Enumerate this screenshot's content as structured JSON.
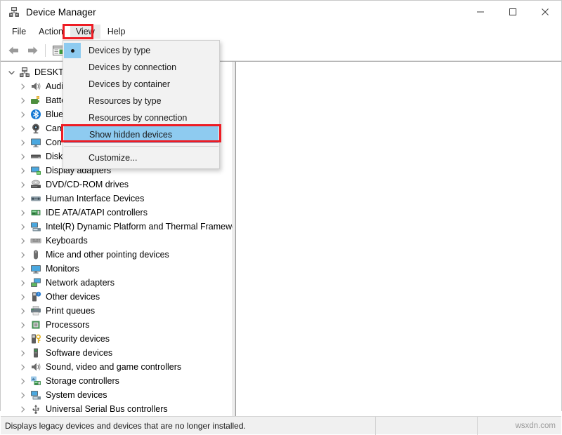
{
  "window": {
    "title": "Device Manager",
    "icon": "device-manager-icon",
    "controls": {
      "minimize": "minimize-icon",
      "maximize": "maximize-icon",
      "close": "close-icon"
    }
  },
  "menubar": {
    "items": [
      {
        "label": "File",
        "open": false
      },
      {
        "label": "Action",
        "open": false
      },
      {
        "label": "View",
        "open": true
      },
      {
        "label": "Help",
        "open": false
      }
    ],
    "highlighted_item": "View"
  },
  "toolbar": {
    "buttons": [
      {
        "name": "back-button",
        "icon": "back-arrow-icon"
      },
      {
        "name": "forward-button",
        "icon": "forward-arrow-icon"
      },
      {
        "name": "properties-button",
        "icon": "properties-icon"
      }
    ]
  },
  "view_menu": {
    "items": [
      {
        "label": "Devices by type",
        "checked": true,
        "highlighted": false,
        "separator_before": false
      },
      {
        "label": "Devices by connection",
        "checked": false,
        "highlighted": false,
        "separator_before": false
      },
      {
        "label": "Devices by container",
        "checked": false,
        "highlighted": false,
        "separator_before": false
      },
      {
        "label": "Resources by type",
        "checked": false,
        "highlighted": false,
        "separator_before": false
      },
      {
        "label": "Resources by connection",
        "checked": false,
        "highlighted": false,
        "separator_before": false
      },
      {
        "label": "Show hidden devices",
        "checked": false,
        "highlighted": true,
        "separator_before": false
      },
      {
        "label": "Customize...",
        "checked": false,
        "highlighted": false,
        "separator_before": true
      }
    ],
    "highlighted_item": "Show hidden devices"
  },
  "tree": {
    "root": {
      "label": "DESKTOP",
      "icon": "computer-icon",
      "expanded": true
    },
    "items": [
      {
        "label": "Audio inputs and outputs",
        "icon": "speaker-icon"
      },
      {
        "label": "Batteries",
        "icon": "battery-icon"
      },
      {
        "label": "Bluetooth",
        "icon": "bluetooth-icon"
      },
      {
        "label": "Cameras",
        "icon": "camera-icon"
      },
      {
        "label": "Computer",
        "icon": "monitor-icon"
      },
      {
        "label": "Disk drives",
        "icon": "disk-icon"
      },
      {
        "label": "Display adapters",
        "icon": "display-adapter-icon"
      },
      {
        "label": "DVD/CD-ROM drives",
        "icon": "optical-drive-icon"
      },
      {
        "label": "Human Interface Devices",
        "icon": "hid-icon"
      },
      {
        "label": "IDE ATA/ATAPI controllers",
        "icon": "ide-controller-icon"
      },
      {
        "label": "Intel(R) Dynamic Platform and Thermal Framework",
        "icon": "system-device-icon"
      },
      {
        "label": "Keyboards",
        "icon": "keyboard-icon"
      },
      {
        "label": "Mice and other pointing devices",
        "icon": "mouse-icon"
      },
      {
        "label": "Monitors",
        "icon": "monitor-icon"
      },
      {
        "label": "Network adapters",
        "icon": "network-icon"
      },
      {
        "label": "Other devices",
        "icon": "other-device-icon"
      },
      {
        "label": "Print queues",
        "icon": "printer-icon"
      },
      {
        "label": "Processors",
        "icon": "processor-icon"
      },
      {
        "label": "Security devices",
        "icon": "security-icon"
      },
      {
        "label": "Software devices",
        "icon": "software-device-icon"
      },
      {
        "label": "Sound, video and game controllers",
        "icon": "speaker-icon"
      },
      {
        "label": "Storage controllers",
        "icon": "storage-controller-icon"
      },
      {
        "label": "System devices",
        "icon": "system-device-icon"
      },
      {
        "label": "Universal Serial Bus controllers",
        "icon": "usb-icon"
      }
    ]
  },
  "statusbar": {
    "message": "Displays legacy devices and devices that are no longer installed.",
    "watermark": "wsxdn.com"
  },
  "colors": {
    "highlight_blue": "#8ecbf0",
    "annotation_red": "#ee1c24",
    "menu_bg": "#f2f2f2",
    "status_bg": "#f0f0f0"
  }
}
